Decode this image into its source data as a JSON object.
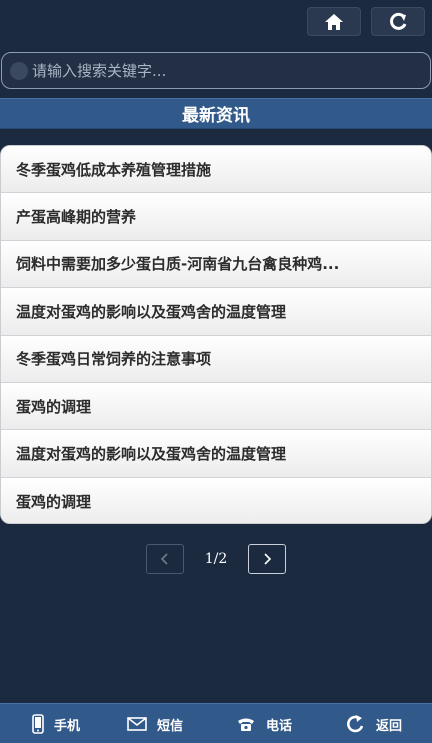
{
  "search": {
    "placeholder": "请输入搜索关键字..."
  },
  "section": {
    "title": "最新资讯"
  },
  "news": [
    "冬季蛋鸡低成本养殖管理措施",
    "产蛋高峰期的营养",
    "饲料中需要加多少蛋白质-河南省九台禽良种鸡...",
    "温度对蛋鸡的影响以及蛋鸡舍的温度管理",
    "冬季蛋鸡日常饲养的注意事项",
    "蛋鸡的调理",
    "温度对蛋鸡的影响以及蛋鸡舍的温度管理",
    "蛋鸡的调理"
  ],
  "pager": {
    "page": "1/2"
  },
  "bottom_nav": {
    "phone": "手机",
    "sms": "短信",
    "call": "电话",
    "back": "返回"
  },
  "icons": {
    "top": [
      "home-icon",
      "refresh-icon"
    ],
    "pager": [
      "chevron-left-icon",
      "chevron-right-icon"
    ],
    "bottom": [
      "mobile-phone-icon",
      "envelope-icon",
      "telephone-icon",
      "back-arrow-icon"
    ]
  },
  "colors": {
    "background": "#1b2a3f",
    "header_bar": "#31598a",
    "list_bg": "#f7f7f7",
    "text_dark": "#2c2c2c"
  }
}
